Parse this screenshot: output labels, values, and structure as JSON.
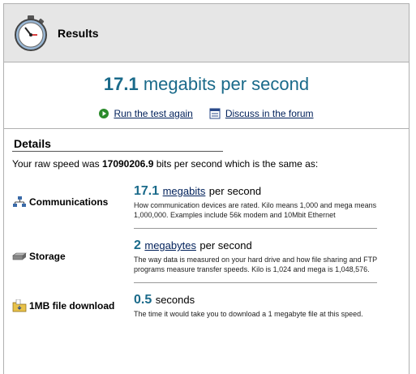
{
  "header": {
    "title": "Results"
  },
  "summary": {
    "speed_value": "17.1",
    "speed_unit": "megabits per second",
    "run_again": "Run the test again",
    "discuss": "Discuss in the forum"
  },
  "details": {
    "heading": "Details",
    "raw_prefix": "Your raw speed was",
    "raw_value": "17090206.9",
    "raw_suffix": "bits per second which is the same as:",
    "rows": [
      {
        "label": "Communications",
        "icon": "network-icon",
        "value": "17.1",
        "unit_link": "megabits",
        "unit_rest": "per second",
        "description": "How communication devices are rated. Kilo means 1,000 and mega means 1,000,000. Examples include 56k modem and 10Mbit Ethernet"
      },
      {
        "label": "Storage",
        "icon": "hard-drive-icon",
        "value": "2",
        "unit_link": "megabytes",
        "unit_rest": "per second",
        "description": "The way data is measured on your hard drive and how file sharing and FTP programs measure transfer speeds. Kilo is 1,024 and mega is 1,048,576."
      },
      {
        "label": "1MB file download",
        "icon": "folder-download-icon",
        "value": "0.5",
        "unit_link": "",
        "unit_rest": "seconds",
        "description": "The time it would take you to download a 1 megabyte file at this speed."
      }
    ]
  },
  "colors": {
    "accent": "#1a6a8a",
    "link": "#00205a",
    "header_bg": "#e6e6e6"
  }
}
